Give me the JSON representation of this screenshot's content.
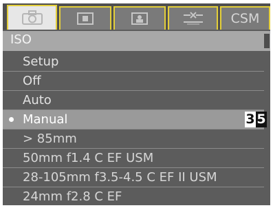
{
  "tabs": [
    {
      "icon": "camera-icon",
      "active": true
    },
    {
      "icon": "photo-icon",
      "active": false
    },
    {
      "icon": "portrait-icon",
      "active": false
    },
    {
      "icon": "custom-function-icon",
      "active": false
    },
    {
      "label": "CSM",
      "active": false
    }
  ],
  "menu": {
    "title": "ISO",
    "items": [
      "Setup",
      "Off",
      "Auto",
      "Manual"
    ],
    "selected": "Manual",
    "value_digits": [
      "3",
      "5"
    ],
    "lens_items": [
      "> 85mm",
      "50mm f1.4 C EF USM",
      "28-105mm f3.5-4.5 C EF II USM",
      "24mm f2.8 C EF"
    ]
  },
  "colors": {
    "tab_accent": "#e4cf3a",
    "selected_row": "#9a9a9a",
    "background": "#5c5c5c"
  }
}
